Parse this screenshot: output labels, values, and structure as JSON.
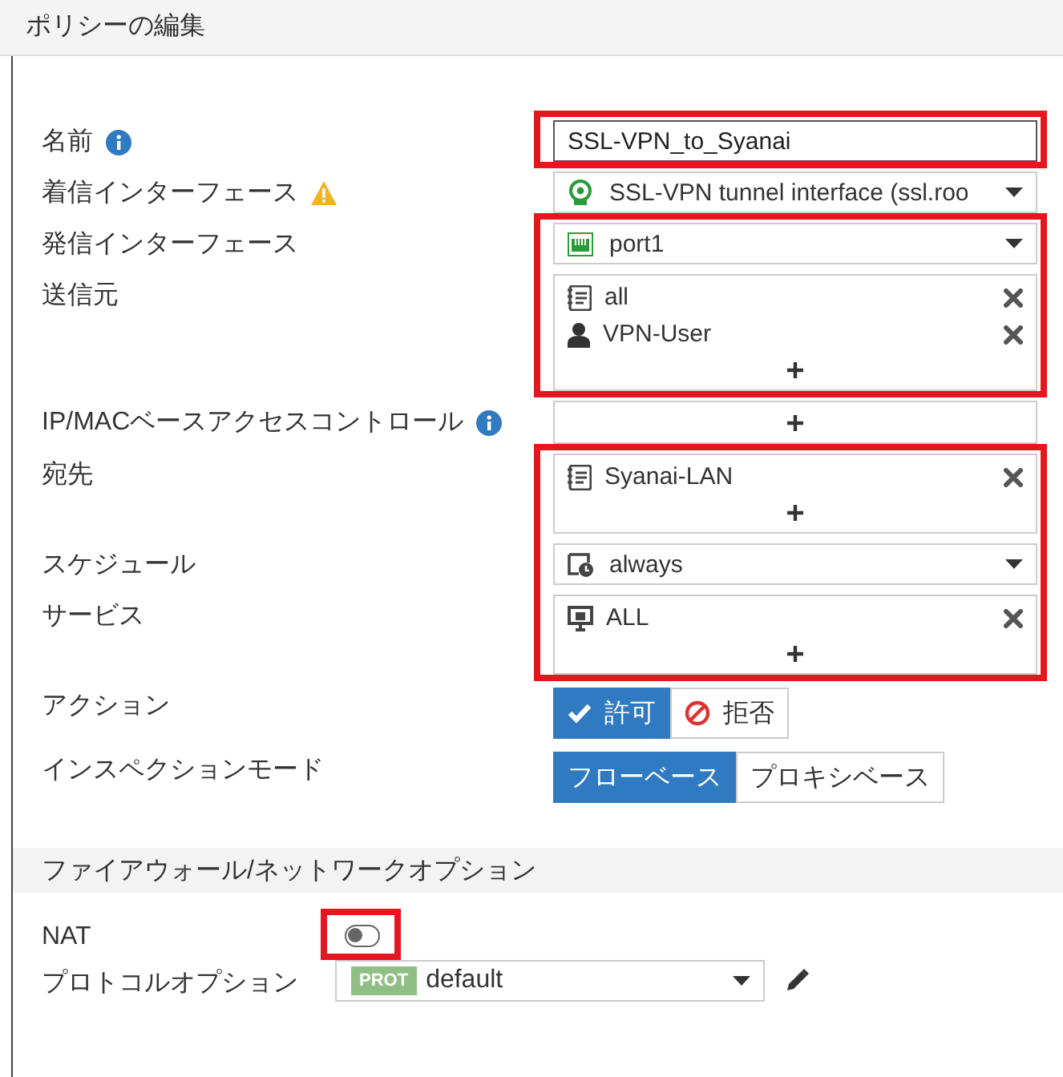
{
  "title": "ポリシーの編集",
  "fields": [
    {
      "label": "名前",
      "info": true,
      "kind": "text",
      "value": "SSL-VPN_to_Syanai",
      "highlighted": true
    },
    {
      "label": "着信インターフェース",
      "warning": true,
      "kind": "select",
      "value": {
        "text": "SSL-VPN tunnel interface (ssl.roo",
        "kind": "tunnel"
      },
      "highlighted": false
    },
    {
      "label": "発信インターフェース",
      "kind": "select",
      "value": {
        "text": "port1",
        "kind": "port"
      },
      "highlighted": true
    },
    {
      "label": "送信元",
      "kind": "list",
      "items": [
        {
          "text": "all",
          "kind": "address"
        },
        {
          "text": "VPN-User",
          "kind": "user"
        }
      ],
      "highlighted": true
    },
    {
      "label": "IP/MACベースアクセスコントロール",
      "info": true,
      "kind": "list",
      "highlighted": false
    },
    {
      "label": "宛先",
      "kind": "list",
      "items": [
        {
          "text": "Syanai-LAN",
          "kind": "address"
        }
      ],
      "highlighted": true
    },
    {
      "label": "スケジュール",
      "kind": "select",
      "value": {
        "text": "always",
        "kind": "schedule"
      },
      "highlighted": true
    },
    {
      "label": "サービス",
      "kind": "list",
      "items": [
        {
          "text": "ALL",
          "kind": "service"
        }
      ],
      "highlighted": true
    },
    {
      "label": "アクション",
      "kind": "segmented",
      "options": [
        {
          "text": "許可",
          "kind": "accept",
          "selected": true
        },
        {
          "text": "拒否",
          "kind": "deny",
          "selected": false
        }
      ],
      "highlighted": false
    },
    {
      "label": "インスペクションモード",
      "kind": "segmented",
      "options": [
        {
          "text": "フローベース",
          "kind": "plain",
          "selected": true
        },
        {
          "text": "プロキシベース",
          "kind": "plain",
          "selected": false
        }
      ],
      "highlighted": false
    }
  ],
  "section": {
    "title": "ファイアウォール/ネットワークオプション"
  },
  "nat": {
    "label": "NAT",
    "on": false,
    "highlighted": true
  },
  "protocol": {
    "label": "プロトコルオプション",
    "badge": "PROT",
    "value": "default"
  }
}
